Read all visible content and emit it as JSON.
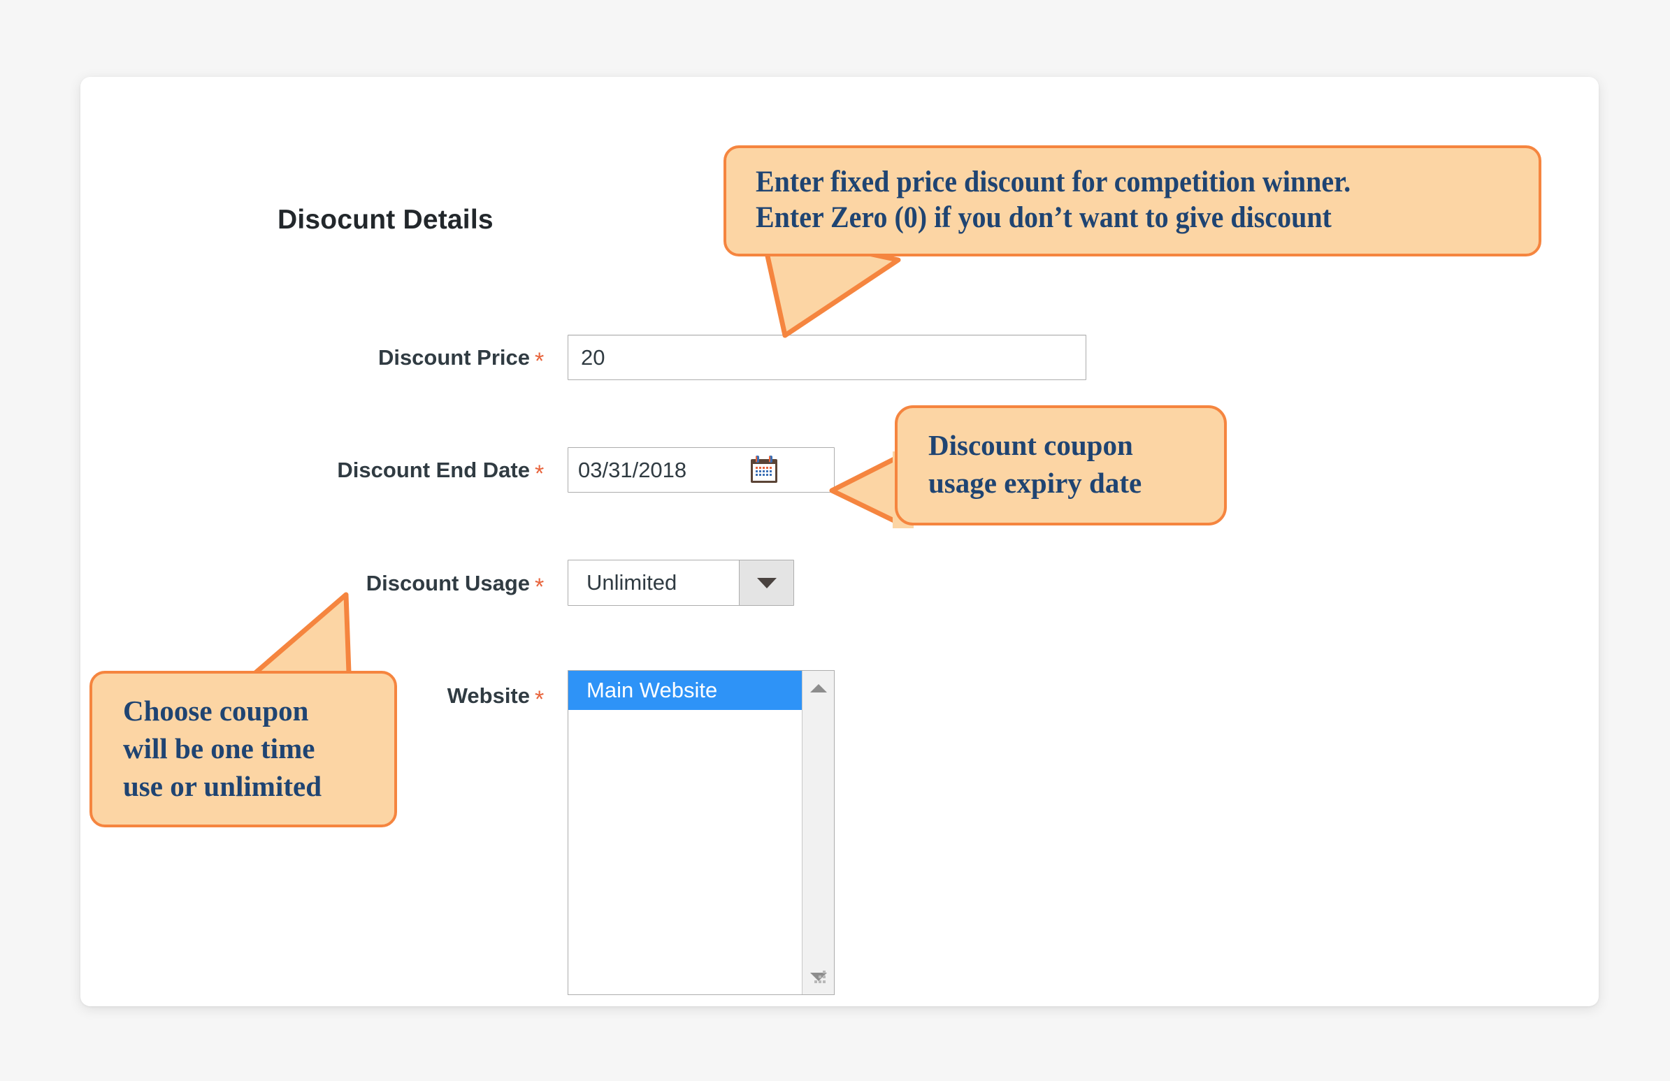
{
  "page": {
    "background_color": "#f6f6f6",
    "card_background": "#ffffff"
  },
  "colors": {
    "accent_required": "#e8643c",
    "callout_fill": "#fcd5a4",
    "callout_border": "#f5853f",
    "callout_text": "#1f4472",
    "selected_option": "#2e93f7",
    "label_text": "#303b42",
    "input_border": "#adadad"
  },
  "form": {
    "section_title": "Disocunt Details",
    "fields": [
      {
        "label": "Discount Price",
        "required_marker": "*",
        "type": "text",
        "value": "20",
        "placeholder": ""
      },
      {
        "label": "Discount End Date",
        "required_marker": "*",
        "type": "date",
        "value": "03/31/2018",
        "placeholder": "",
        "icon": "calendar-icon"
      },
      {
        "label": "Discount Usage",
        "required_marker": "*",
        "type": "select",
        "value": "Unlimited",
        "options": [
          "Unlimited"
        ],
        "icon": "chevron-down-icon"
      },
      {
        "label": "Website",
        "required_marker": "*",
        "type": "multiselect",
        "options": [
          "Main Website"
        ],
        "selected": [
          "Main Website"
        ]
      }
    ]
  },
  "callouts": [
    {
      "id": "discount-price-callout",
      "lines": [
        "Enter fixed price discount for competition winner.",
        "Enter Zero (0) if you don’t want to give discount"
      ],
      "points_to": "Discount Price"
    },
    {
      "id": "discount-end-date-callout",
      "lines": [
        "Discount coupon",
        "usage expiry date"
      ],
      "points_to": "Discount End Date"
    },
    {
      "id": "discount-usage-callout",
      "lines": [
        "Choose coupon",
        "will be one time",
        "use or unlimited"
      ],
      "points_to": "Discount Usage"
    }
  ]
}
